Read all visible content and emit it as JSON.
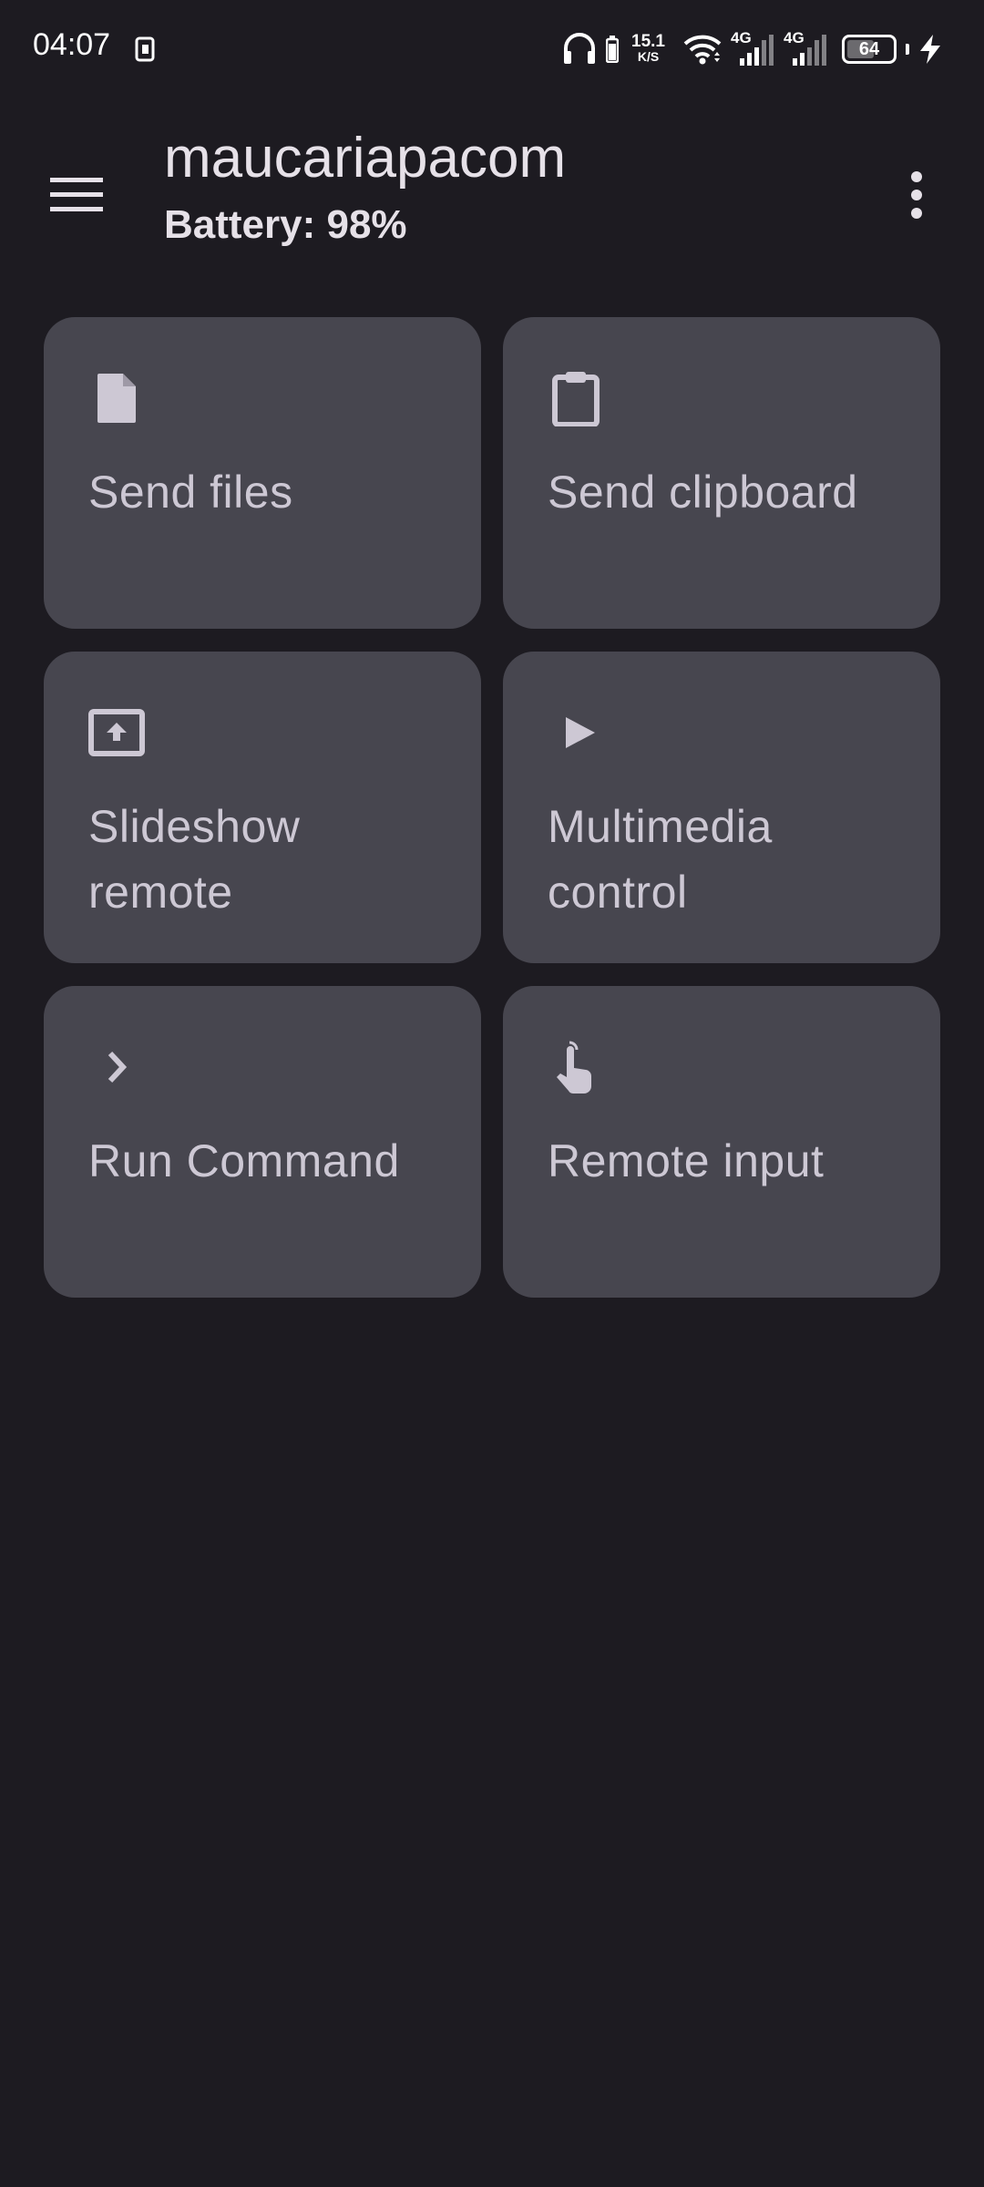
{
  "status_bar": {
    "time": "04:07",
    "net_speed_value": "15.1",
    "net_speed_unit": "K/S",
    "network_1": "4G",
    "network_2": "4G",
    "battery_level": "64",
    "battery_fraction": 0.64
  },
  "app_bar": {
    "title": "maucariapacom",
    "subtitle": "Battery: 98%",
    "menu_icon": "hamburger-menu-icon",
    "overflow_icon": "more-vertical-icon"
  },
  "plugins": [
    {
      "label": "Send files",
      "icon": "file-icon"
    },
    {
      "label": "Send clipboard",
      "icon": "clipboard-icon"
    },
    {
      "label": "Slideshow remote",
      "icon": "presentation-icon"
    },
    {
      "label": "Multimedia control",
      "icon": "play-icon"
    },
    {
      "label": "Run Command",
      "icon": "chevron-right-icon"
    },
    {
      "label": "Remote input",
      "icon": "touch-hand-icon"
    }
  ],
  "colors": {
    "background": "#1d1b21",
    "card": "#47464f",
    "card_text": "#cdc8d4",
    "title_text": "#e6e1e8"
  }
}
